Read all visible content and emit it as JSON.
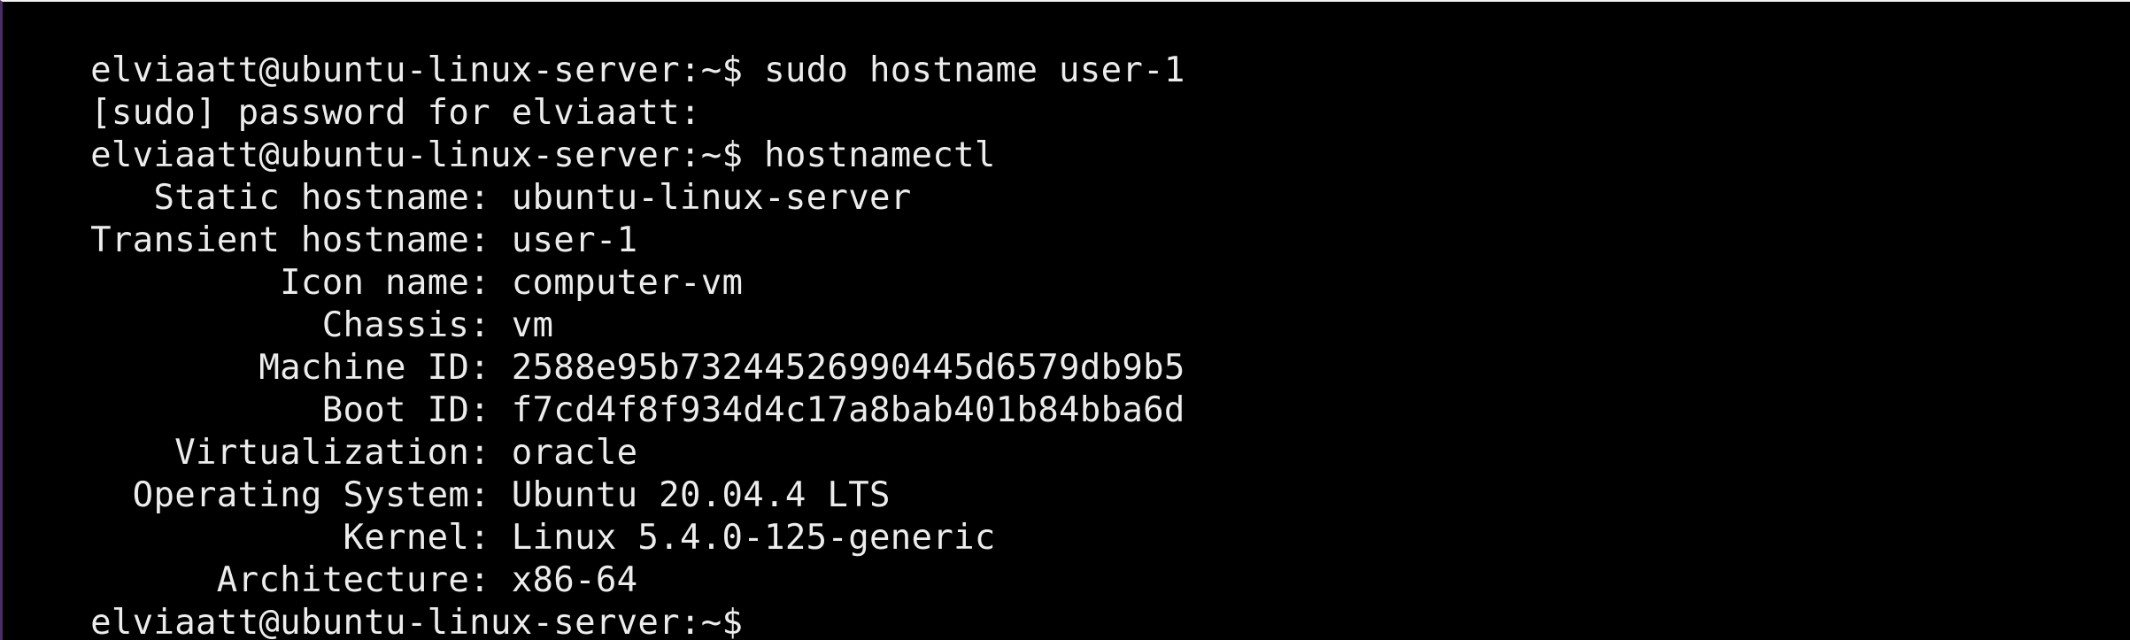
{
  "terminal": {
    "lines": [
      {
        "prompt": "elviaatt@ubuntu-linux-server:~$ ",
        "command": "sudo hostname user-1"
      },
      {
        "text": "[sudo] password for elviaatt:"
      },
      {
        "prompt": "elviaatt@ubuntu-linux-server:~$ ",
        "command": "hostnamectl"
      },
      {
        "text": "   Static hostname: ubuntu-linux-server"
      },
      {
        "text": "Transient hostname: user-1"
      },
      {
        "text": "         Icon name: computer-vm"
      },
      {
        "text": "           Chassis: vm"
      },
      {
        "text": "        Machine ID: 2588e95b73244526990445d6579db9b5"
      },
      {
        "text": "           Boot ID: f7cd4f8f934d4c17a8bab401b84bba6d"
      },
      {
        "text": "    Virtualization: oracle"
      },
      {
        "text": "  Operating System: Ubuntu 20.04.4 LTS"
      },
      {
        "text": "            Kernel: Linux 5.4.0-125-generic"
      },
      {
        "text": "      Architecture: x86-64"
      },
      {
        "prompt": "elviaatt@ubuntu-linux-server:~$",
        "command": ""
      }
    ]
  }
}
